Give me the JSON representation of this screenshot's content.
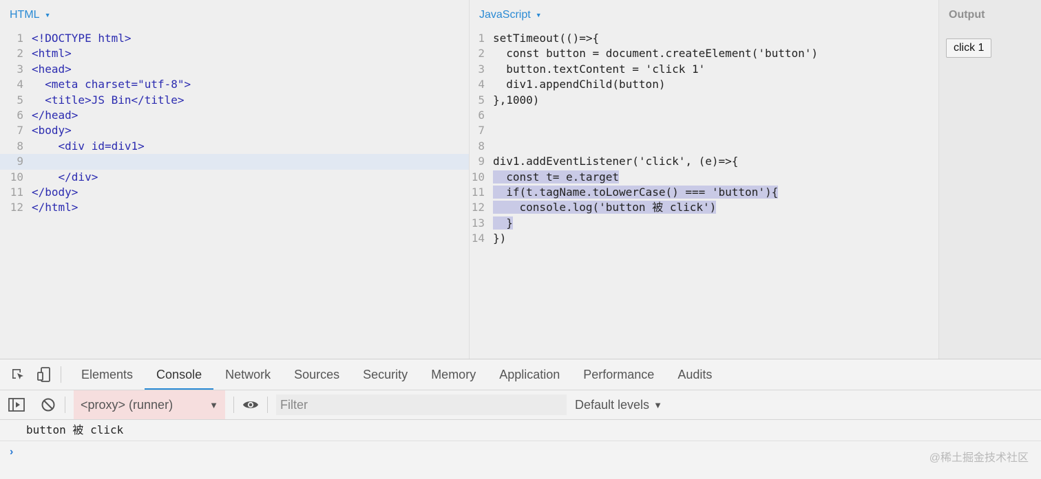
{
  "html_pane": {
    "title": "HTML",
    "lines": [
      "<!DOCTYPE html>",
      "<html>",
      "<head>",
      "  <meta charset=\"utf-8\">",
      "  <title>JS Bin</title>",
      "</head>",
      "<body>",
      "    <div id=div1>",
      "",
      "    </div>",
      "</body>",
      "</html>"
    ]
  },
  "js_pane": {
    "title": "JavaScript",
    "lines": [
      "setTimeout(()=>{",
      "  const button = document.createElement('button')",
      "  button.textContent = 'click 1'",
      "  div1.appendChild(button)",
      "},1000)",
      "",
      "",
      "",
      "div1.addEventListener('click', (e)=>{",
      "  const t= e.target",
      "  if(t.tagName.toLowerCase() === 'button'){",
      "    console.log('button 被 click')",
      "  }",
      "})"
    ]
  },
  "output_pane": {
    "title": "Output",
    "button_label": "click 1"
  },
  "devtools": {
    "tabs": [
      "Elements",
      "Console",
      "Network",
      "Sources",
      "Security",
      "Memory",
      "Application",
      "Performance",
      "Audits"
    ],
    "active_tab": "Console",
    "context": "<proxy> (runner)",
    "filter_placeholder": "Filter",
    "levels": "Default levels",
    "console_messages": [
      "button 被 click"
    ],
    "prompt": "›"
  },
  "watermark": "@稀土掘金技术社区",
  "colors": {
    "accent": "#2a8ad4",
    "selection": "#c9cae6"
  }
}
